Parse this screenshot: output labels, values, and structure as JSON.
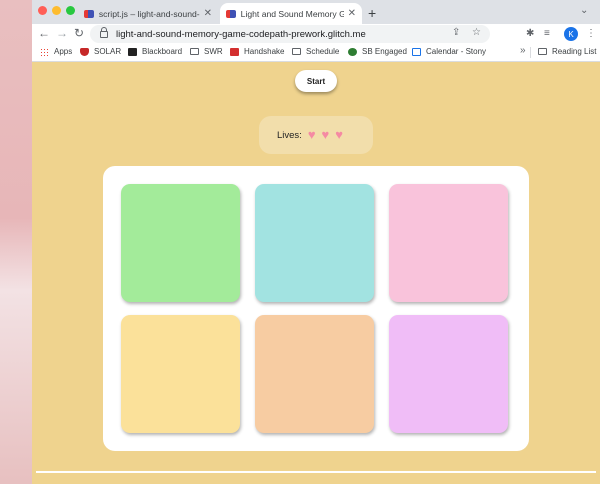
{
  "browser": {
    "tabs": [
      {
        "title": "script.js – light-and-sound-me",
        "active": false
      },
      {
        "title": "Light and Sound Memory Gam",
        "active": true
      }
    ],
    "new_tab_symbol": "+",
    "url": "light-and-sound-memory-game-codepath-prework.glitch.me",
    "avatar_initial": "K",
    "icons": [
      "back-icon",
      "forward-icon",
      "reload-icon",
      "share-icon",
      "star-icon",
      "extensions-icon",
      "media-icon"
    ]
  },
  "bookmarks": {
    "items": [
      "Apps",
      "SOLAR",
      "Blackboard",
      "SWR",
      "Handshake",
      "Schedule",
      "SB Engaged",
      "Calendar - Stony"
    ],
    "more": "»",
    "reading_list": "Reading List"
  },
  "game": {
    "start_label": "Start",
    "lives_label": "Lives:",
    "lives_count": 3,
    "buttons": [
      {
        "id": 1,
        "color": "#a3eb9a"
      },
      {
        "id": 2,
        "color": "#a2e3e1"
      },
      {
        "id": 3,
        "color": "#f9c3db"
      },
      {
        "id": 4,
        "color": "#fbe19a"
      },
      {
        "id": 5,
        "color": "#f7cca2"
      },
      {
        "id": 6,
        "color": "#f0bdf7"
      }
    ]
  }
}
